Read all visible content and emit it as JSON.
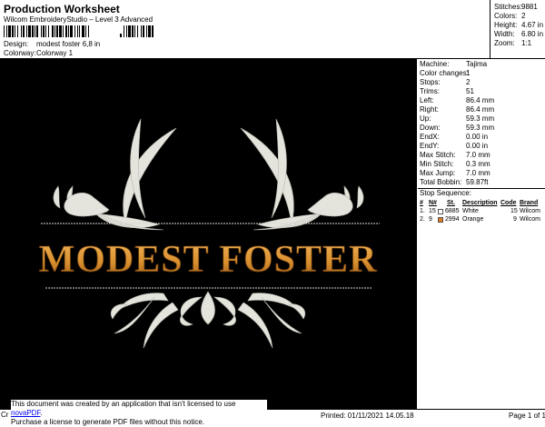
{
  "header": {
    "title": "Production Worksheet",
    "subtitle": "Wilcom EmbroideryStudio – Level 3 Advanced",
    "design_label": "Design:",
    "design_value": "modest foster 6,8 in",
    "colorway_label": "Colorway:",
    "colorway_value": "Colorway 1",
    "barcode_icon": "barcode-icon"
  },
  "stats": [
    {
      "label": "Stitches:",
      "value": "9881"
    },
    {
      "label": "Colors:",
      "value": "2"
    },
    {
      "label": "Height:",
      "value": "4.67 in"
    },
    {
      "label": "Width:",
      "value": "6.80 in"
    },
    {
      "label": "Zoom:",
      "value": "1:1"
    }
  ],
  "design_preview": {
    "text": "Modest Foster",
    "background": "#000000",
    "text_color": "#d99535",
    "ornament_color": "#e4e4dc"
  },
  "machine": [
    {
      "label": "Machine:",
      "value": "Tajima"
    },
    {
      "label": "Color changes:",
      "value": "1"
    },
    {
      "label": "Stops:",
      "value": "2"
    },
    {
      "label": "Trims:",
      "value": "51"
    },
    {
      "label": "Left:",
      "value": "86.4 mm"
    },
    {
      "label": "Right:",
      "value": "86.4 mm"
    },
    {
      "label": "Up:",
      "value": "59.3 mm"
    },
    {
      "label": "Down:",
      "value": "59.3 mm"
    },
    {
      "label": "EndX:",
      "value": "0.00 in"
    },
    {
      "label": "EndY:",
      "value": "0.00 in"
    },
    {
      "label": "Max Stitch:",
      "value": "7.0 mm"
    },
    {
      "label": "Min Stitch:",
      "value": "0.3 mm"
    },
    {
      "label": "Max Jump:",
      "value": "7.0 mm"
    },
    {
      "label": "Total Bobbin:",
      "value": "59.87ft"
    }
  ],
  "stop_sequence": {
    "title": "Stop Sequence:",
    "headers": [
      "#",
      "N#",
      "St.",
      "Description",
      "Code",
      "Brand"
    ],
    "rows": [
      {
        "num": "1.",
        "n": "15",
        "st": "6885",
        "desc": "White",
        "code": "15",
        "brand": "Wilcom",
        "color": "#ffffff"
      },
      {
        "num": "2.",
        "n": "9",
        "st": "2994",
        "desc": "Orange",
        "code": "9",
        "brand": "Wilcom",
        "color": "#e07a1e"
      }
    ]
  },
  "footer": {
    "notice_line1_a": "This document was created by an application that isn't licensed to use ",
    "notice_link": "novaPDF",
    "notice_line1_b": ".",
    "notice_line2": "Purchase a license to generate PDF files without this notice.",
    "cr": "Cr",
    "printed": "Printed: 01/11/2021 14.05.18",
    "page": "Page 1 of 1"
  }
}
